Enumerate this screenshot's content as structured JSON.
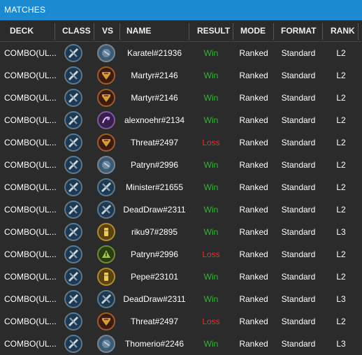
{
  "window": {
    "title": "MATCHES"
  },
  "columns": [
    "DECK",
    "CLASS",
    "VS",
    "NAME",
    "RESULT",
    "MODE",
    "FORMAT",
    "RANK"
  ],
  "colors": {
    "title_bar": "#1c8ad1",
    "background": "#2b2b2b",
    "win": "#2eb82e",
    "loss": "#e53232"
  },
  "matches": [
    {
      "deck": "COMBO(UL...",
      "class_icon": "rogue-class-icon",
      "vs_icon": "shaman-class-icon",
      "name": "Karatel#21936",
      "result": "Win",
      "mode": "Ranked",
      "format": "Standard",
      "rank": "L2"
    },
    {
      "deck": "COMBO(UL...",
      "class_icon": "rogue-class-icon",
      "vs_icon": "warrior-class-icon",
      "name": "Martyr#2146",
      "result": "Win",
      "mode": "Ranked",
      "format": "Standard",
      "rank": "L2"
    },
    {
      "deck": "COMBO(UL...",
      "class_icon": "rogue-class-icon",
      "vs_icon": "warrior-class-icon",
      "name": "Martyr#2146",
      "result": "Win",
      "mode": "Ranked",
      "format": "Standard",
      "rank": "L2"
    },
    {
      "deck": "COMBO(UL...",
      "class_icon": "rogue-class-icon",
      "vs_icon": "warlock-class-icon",
      "name": "alexnoehr#2134",
      "result": "Win",
      "mode": "Ranked",
      "format": "Standard",
      "rank": "L2"
    },
    {
      "deck": "COMBO(UL...",
      "class_icon": "rogue-class-icon",
      "vs_icon": "warrior-class-icon",
      "name": "Threat#2497",
      "result": "Loss",
      "mode": "Ranked",
      "format": "Standard",
      "rank": "L2"
    },
    {
      "deck": "COMBO(UL...",
      "class_icon": "rogue-class-icon",
      "vs_icon": "shaman-class-icon",
      "name": "Patryn#2996",
      "result": "Win",
      "mode": "Ranked",
      "format": "Standard",
      "rank": "L2"
    },
    {
      "deck": "COMBO(UL...",
      "class_icon": "rogue-class-icon",
      "vs_icon": "rogue-class-icon",
      "name": "Minister#21655",
      "result": "Win",
      "mode": "Ranked",
      "format": "Standard",
      "rank": "L2"
    },
    {
      "deck": "COMBO(UL...",
      "class_icon": "rogue-class-icon",
      "vs_icon": "rogue-class-icon",
      "name": "DeadDraw#2311",
      "result": "Win",
      "mode": "Ranked",
      "format": "Standard",
      "rank": "L2"
    },
    {
      "deck": "COMBO(UL...",
      "class_icon": "rogue-class-icon",
      "vs_icon": "paladin-class-icon",
      "name": "riku97#2895",
      "result": "Win",
      "mode": "Ranked",
      "format": "Standard",
      "rank": "L3"
    },
    {
      "deck": "COMBO(UL...",
      "class_icon": "rogue-class-icon",
      "vs_icon": "hunter-class-icon",
      "name": "Patryn#2996",
      "result": "Loss",
      "mode": "Ranked",
      "format": "Standard",
      "rank": "L2"
    },
    {
      "deck": "COMBO(UL...",
      "class_icon": "rogue-class-icon",
      "vs_icon": "paladin-class-icon",
      "name": "Pepe#23101",
      "result": "Win",
      "mode": "Ranked",
      "format": "Standard",
      "rank": "L2"
    },
    {
      "deck": "COMBO(UL...",
      "class_icon": "rogue-class-icon",
      "vs_icon": "rogue-class-icon",
      "name": "DeadDraw#2311",
      "result": "Win",
      "mode": "Ranked",
      "format": "Standard",
      "rank": "L3"
    },
    {
      "deck": "COMBO(UL...",
      "class_icon": "rogue-class-icon",
      "vs_icon": "warrior-class-icon",
      "name": "Threat#2497",
      "result": "Loss",
      "mode": "Ranked",
      "format": "Standard",
      "rank": "L2"
    },
    {
      "deck": "COMBO(UL...",
      "class_icon": "rogue-class-icon",
      "vs_icon": "shaman-class-icon",
      "name": "Thomerio#2246",
      "result": "Win",
      "mode": "Ranked",
      "format": "Standard",
      "rank": "L3"
    }
  ]
}
